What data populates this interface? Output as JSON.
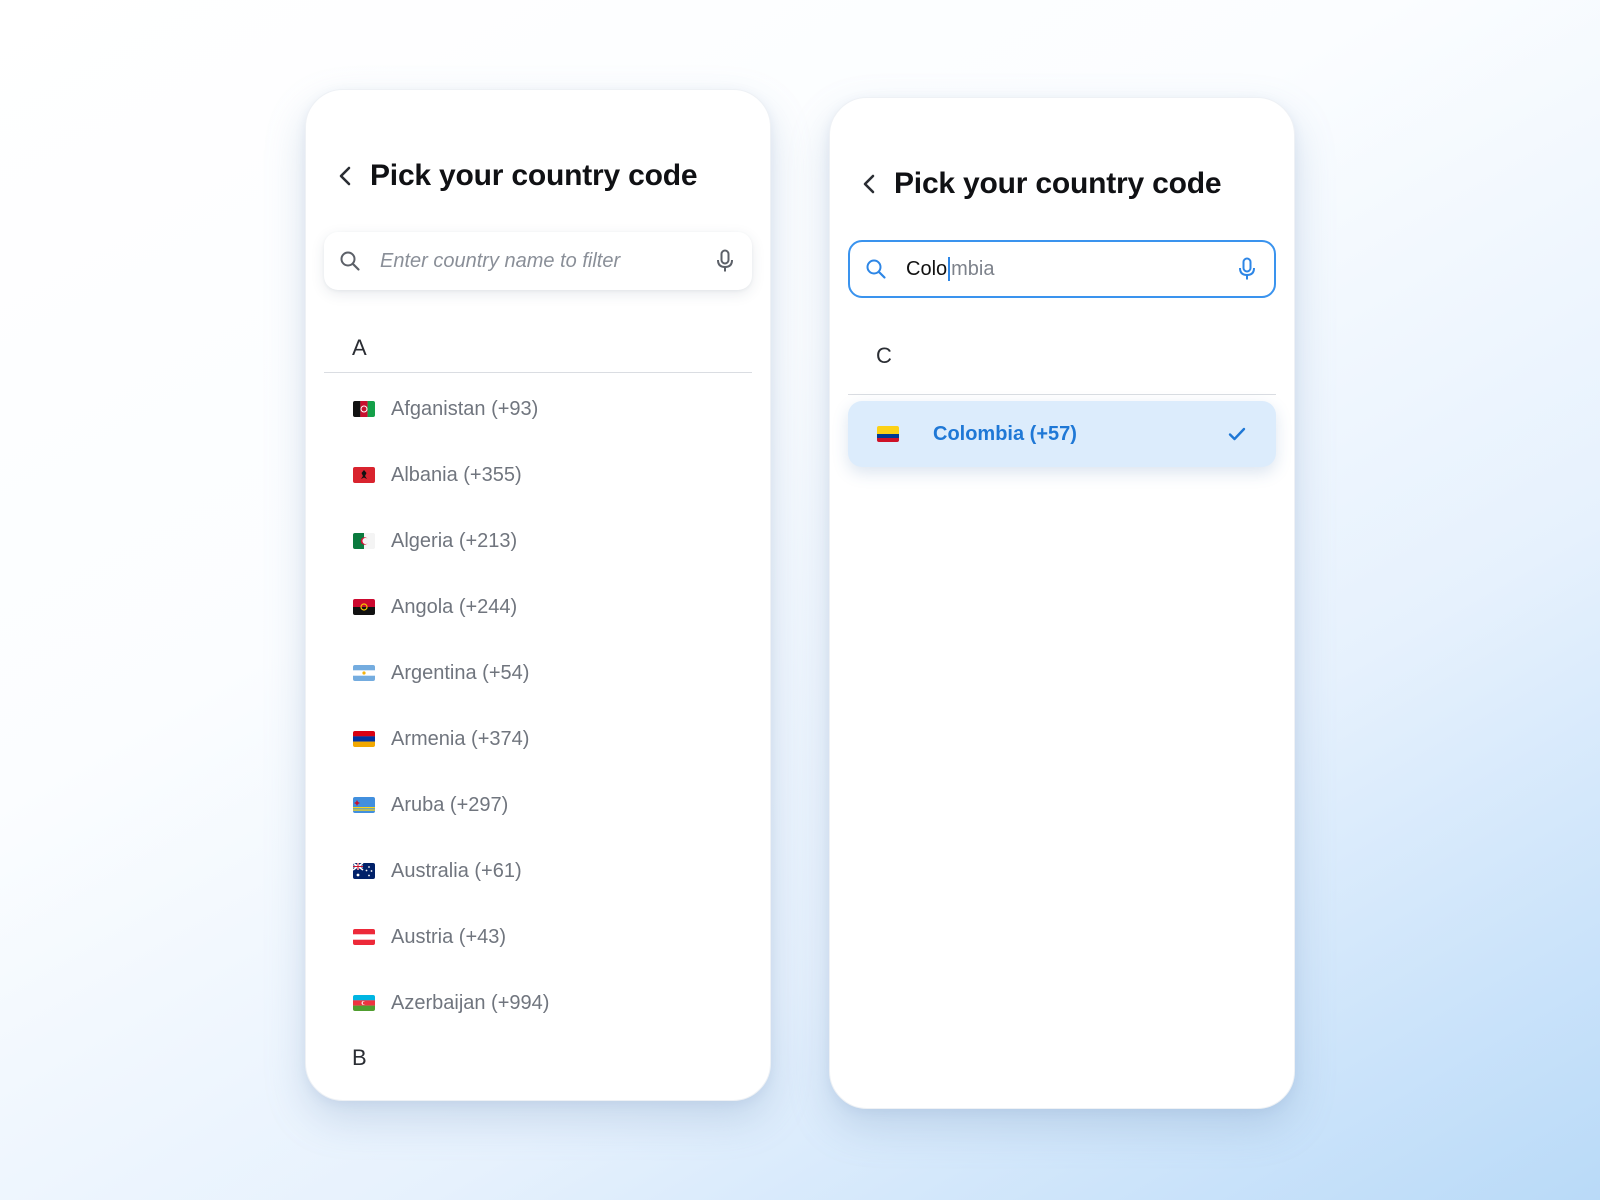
{
  "list_screen": {
    "title": "Pick your country code",
    "search_placeholder": "Enter country name to filter",
    "section_a": "A",
    "section_b": "B",
    "countries": [
      {
        "label": "Afganistan (+93)",
        "flag": "afghanistan-flag-icon"
      },
      {
        "label": "Albania (+355)",
        "flag": "albania-flag-icon"
      },
      {
        "label": "Algeria (+213)",
        "flag": "algeria-flag-icon"
      },
      {
        "label": "Angola (+244)",
        "flag": "angola-flag-icon"
      },
      {
        "label": "Argentina (+54)",
        "flag": "argentina-flag-icon"
      },
      {
        "label": "Armenia (+374)",
        "flag": "armenia-flag-icon"
      },
      {
        "label": "Aruba (+297)",
        "flag": "aruba-flag-icon"
      },
      {
        "label": "Australia (+61)",
        "flag": "australia-flag-icon"
      },
      {
        "label": "Austria (+43)",
        "flag": "austria-flag-icon"
      },
      {
        "label": "Azerbaijan (+994)",
        "flag": "azerbaijan-flag-icon"
      }
    ]
  },
  "search_screen": {
    "title": "Pick your country code",
    "search_typed": "Colo",
    "search_suggestion": "mbia",
    "section_c": "C",
    "result": {
      "label": "Colombia (+57)",
      "flag": "colombia-flag-icon",
      "selected": true
    }
  },
  "colors": {
    "accent": "#3a93ee",
    "selected_bg": "#dcecfc",
    "selected_text": "#1f78d6",
    "title_text": "#101114",
    "item_text": "#70757e"
  },
  "icons": [
    "chevron-left-icon",
    "search-icon",
    "microphone-icon",
    "checkmark-icon"
  ]
}
